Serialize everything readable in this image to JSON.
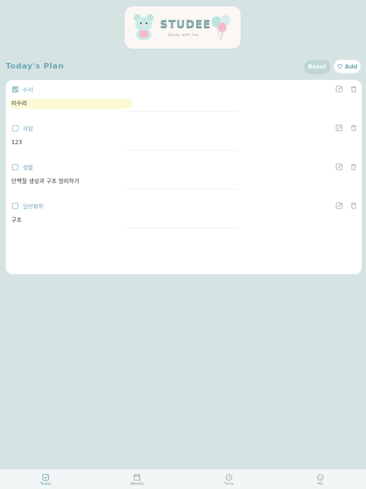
{
  "logo": {
    "title": "STUDEE",
    "subtitle": "Study with me"
  },
  "plan": {
    "title": "Today's Plan",
    "reset_label": "Reset",
    "add_label": "Add"
  },
  "items": [
    {
      "subject": "수리",
      "task": "미수리",
      "checked": true
    },
    {
      "subject": "과탐",
      "task": "123",
      "checked": false
    },
    {
      "subject": "생물",
      "task": "단백질 생성과 구조 정리하기",
      "checked": false
    },
    {
      "subject": "일반화학",
      "task": "구조",
      "checked": false
    }
  ],
  "tabs": [
    {
      "label": "Today",
      "icon": "check-square-icon",
      "active": true
    },
    {
      "label": "Weekly",
      "icon": "calendar-icon",
      "active": false
    },
    {
      "label": "Time",
      "icon": "clock-icon",
      "active": false
    },
    {
      "label": "My",
      "icon": "smile-icon",
      "active": false
    }
  ],
  "colors": {
    "background": "#d5e4e3",
    "accent": "#6fa8b5",
    "highlight": "#fbfad5"
  }
}
